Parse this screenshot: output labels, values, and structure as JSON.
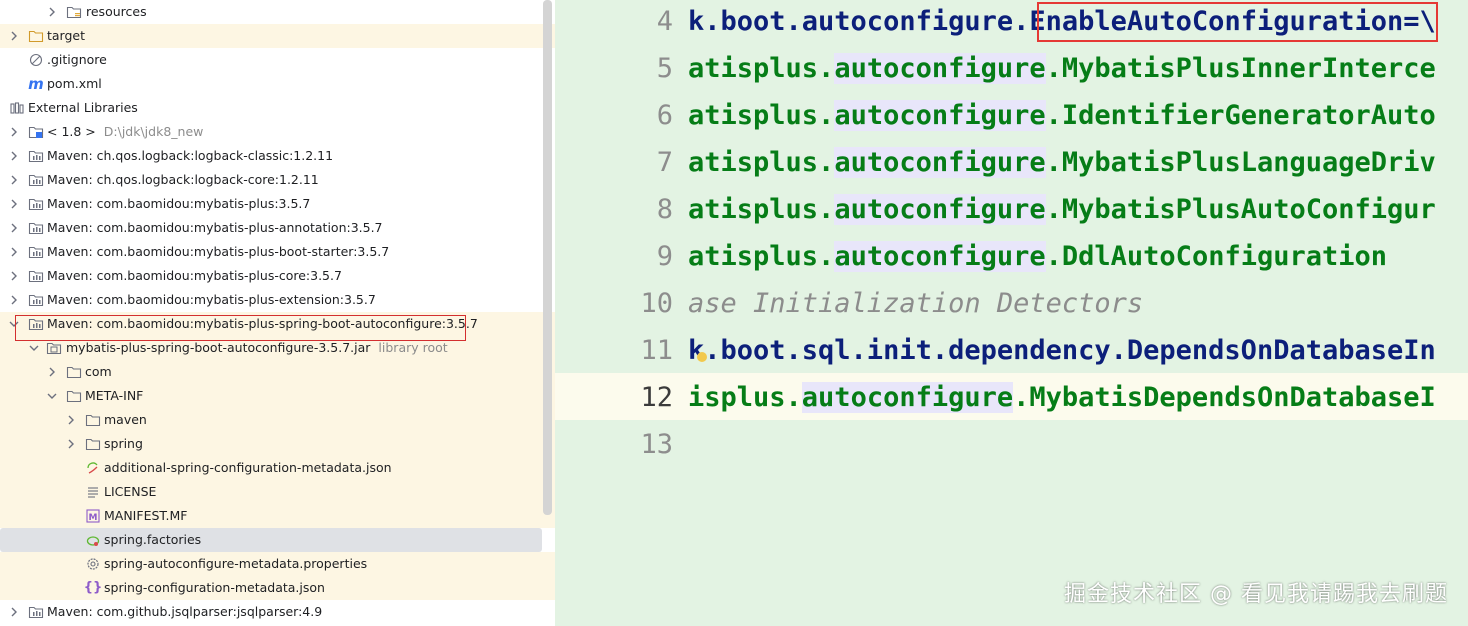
{
  "tree": {
    "rows": [
      {
        "label": "resources",
        "icon": "folder-resources-icon",
        "expanded": false
      },
      {
        "label": "target",
        "icon": "folder-icon",
        "expanded": false
      },
      {
        "label": ".gitignore",
        "icon": "gitignore-icon"
      },
      {
        "label": "pom.xml",
        "icon": "maven-icon"
      },
      {
        "label": "External Libraries",
        "icon": "library-icon",
        "expanded": true
      },
      {
        "label": "< 1.8 >",
        "sub": "D:\\jdk\\jdk8_new",
        "icon": "jdk-folder-icon",
        "expanded": false
      },
      {
        "label": "Maven: ch.qos.logback:logback-classic:1.2.11",
        "icon": "library-icon",
        "expanded": false
      },
      {
        "label": "Maven: ch.qos.logback:logback-core:1.2.11",
        "icon": "library-icon",
        "expanded": false
      },
      {
        "label": "Maven: com.baomidou:mybatis-plus:3.5.7",
        "icon": "library-icon",
        "expanded": false
      },
      {
        "label": "Maven: com.baomidou:mybatis-plus-annotation:3.5.7",
        "icon": "library-icon",
        "expanded": false
      },
      {
        "label": "Maven: com.baomidou:mybatis-plus-boot-starter:3.5.7",
        "icon": "library-icon",
        "expanded": false
      },
      {
        "label": "Maven: com.baomidou:mybatis-plus-core:3.5.7",
        "icon": "library-icon",
        "expanded": false
      },
      {
        "label": "Maven: com.baomidou:mybatis-plus-extension:3.5.7",
        "icon": "library-icon",
        "expanded": false
      },
      {
        "label": "Maven: com.baomidou:mybatis-plus-spring-boot-autoconfigure:3.5.7",
        "icon": "library-icon",
        "expanded": true
      },
      {
        "label": "mybatis-plus-spring-boot-autoconfigure-3.5.7.jar",
        "sub": "library root",
        "icon": "jar-icon",
        "expanded": true
      },
      {
        "label": "com",
        "icon": "folder-icon",
        "expanded": false
      },
      {
        "label": "META-INF",
        "icon": "folder-icon",
        "expanded": true
      },
      {
        "label": "maven",
        "icon": "folder-icon",
        "expanded": false
      },
      {
        "label": "spring",
        "icon": "folder-icon",
        "expanded": false
      },
      {
        "label": "additional-spring-configuration-metadata.json",
        "icon": "spring-json-icon"
      },
      {
        "label": "LICENSE",
        "icon": "text-file-icon"
      },
      {
        "label": "MANIFEST.MF",
        "icon": "manifest-icon"
      },
      {
        "label": "spring.factories",
        "icon": "spring-leaf-icon"
      },
      {
        "label": "spring-autoconfigure-metadata.properties",
        "icon": "properties-gear-icon"
      },
      {
        "label": "spring-configuration-metadata.json",
        "icon": "json-braces-icon"
      },
      {
        "label": "Maven: com.github.jsqlparser:jsqlparser:4.9",
        "icon": "library-icon",
        "expanded": false
      }
    ]
  },
  "editor": {
    "lines": [
      {
        "num": "4"
      },
      {
        "num": "5"
      },
      {
        "num": "6"
      },
      {
        "num": "7"
      },
      {
        "num": "8"
      },
      {
        "num": "9"
      },
      {
        "num": "10"
      },
      {
        "num": "11"
      },
      {
        "num": "12"
      },
      {
        "num": "13"
      }
    ],
    "code": {
      "l4_a": "k.boot.autoconfigure.",
      "l4_b": "EnableAutoConfiguration",
      "l4_c": "=\\",
      "l5_a": "atisplus.",
      "l5_b": "autoconfigure",
      "l5_c": ".MybatisPlusInnerInterce",
      "l6_a": "atisplus.",
      "l6_b": "autoconfigure",
      "l6_c": ".IdentifierGeneratorAuto",
      "l7_a": "atisplus.",
      "l7_b": "autoconfigure",
      "l7_c": ".MybatisPlusLanguageDriv",
      "l8_a": "atisplus.",
      "l8_b": "autoconfigure",
      "l8_c": ".MybatisPlusAutoConfigur",
      "l9_a": "atisplus.",
      "l9_b": "autoconfigure",
      "l9_c": ".DdlAutoConfiguration",
      "l10": "ase Initialization Detectors",
      "l11": "k.boot.sql.init.dependency.DependsOnDatabaseIn",
      "l12_a": "isplus.",
      "l12_b": "autoconfigure",
      "l12_c": ".MybatisDependsOnDatabaseI"
    }
  },
  "watermark": "掘金技术社区 @ 看见我请踢我去刷题",
  "colors": {
    "editor_bg": "#e3f3e3",
    "code_green": "#067d17",
    "code_navy": "#0c1f7a",
    "highlight": "#e8e6fa",
    "annotation_red": "#e53935",
    "tree_yellow": "#fdf6e3",
    "tree_selected": "#dfe1e5"
  }
}
